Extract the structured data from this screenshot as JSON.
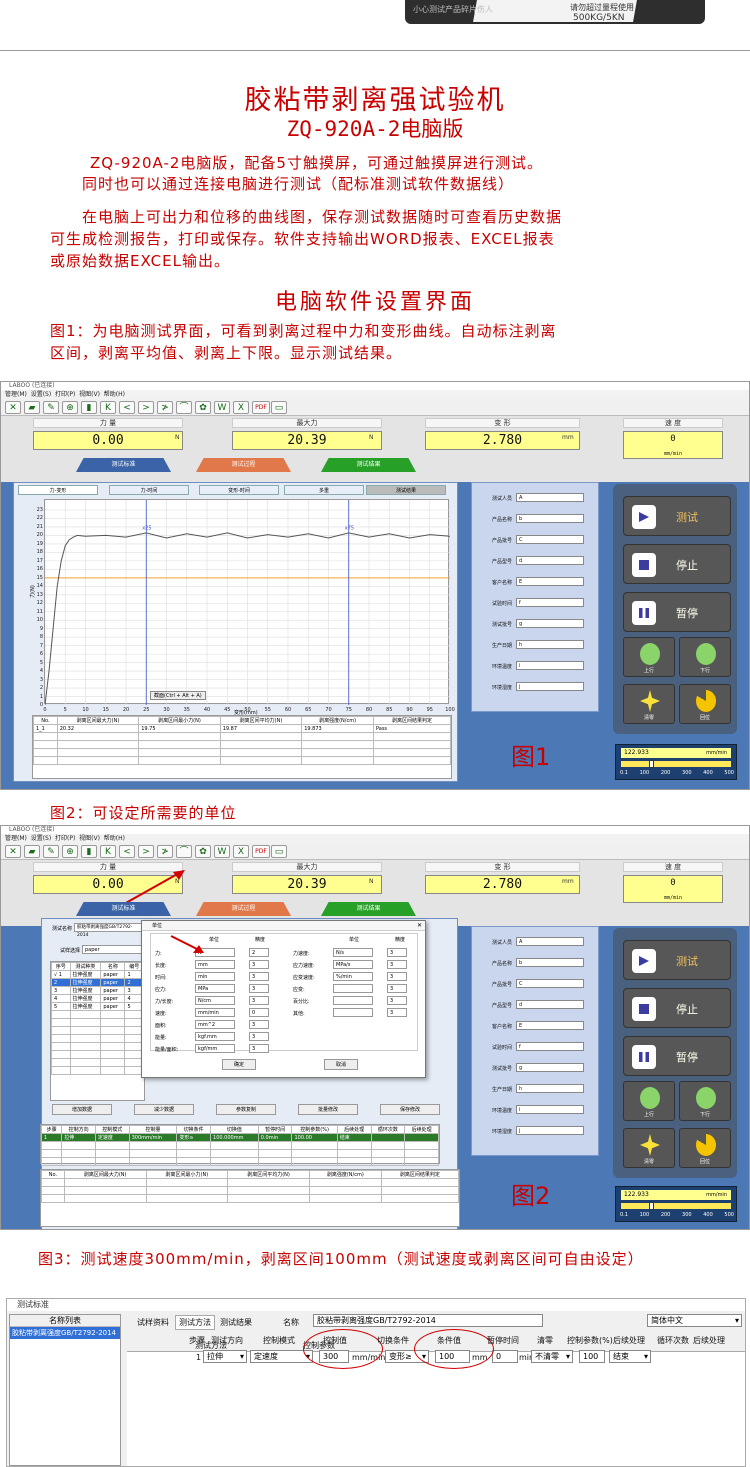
{
  "top_photo": {
    "caption_left": "小心测试产品碎片伤人",
    "caption_right": "请勿超过量程使用",
    "model_label": "500KG/5KN"
  },
  "title": "胶粘带剥离强试验机",
  "model": "ZQ-920A-2电脑版",
  "intro_lines": [
    "ZQ-920A-2电脑版，配备5寸触摸屏，可通过触摸屏进行测试。",
    "同时也可以通过连接电脑进行测试（配标准测试软件数据线）"
  ],
  "desc_lines": [
    "在电脑上可出力和位移的曲线图，保存测试数据随时可查看历史数据",
    "可生成检测报告，打印或保存。软件支持输出WORD报表、EXCEL报表",
    "或原始数据EXCEL输出。"
  ],
  "section_title": "电脑软件设置界面",
  "fig1_caption_lines": [
    "图1：为电脑测试界面，可看到剥离过程中力和变形曲线。自动标注剥离",
    "区间，剥离平均值、剥离上下限。显示测试结果。"
  ],
  "fig2_caption": "图2：可设定所需要的单位",
  "fig3_caption": "图3：测试速度300mm/min，剥离区间100mm（测试速度或剥离区间可自由设定）",
  "app": {
    "window_title": "LABOO (已连接)",
    "menu": [
      "管理(M)",
      "设置(S)",
      "打印(P)",
      "视图(V)",
      "帮助(H)"
    ],
    "toolbar_icons": [
      "tool-icon",
      "open-icon",
      "edit-icon",
      "zoom-icon",
      "delete-icon",
      "first-icon",
      "prev-icon",
      "next-icon",
      "last-icon",
      "curve-icon",
      "leaf-icon",
      "word-icon",
      "excel-icon",
      "pdf-icon",
      "monitor-icon"
    ],
    "toolbar_glyphs": [
      "✕",
      "▰",
      "✎",
      "⊕",
      "▮",
      "K",
      "<",
      ">",
      "≯",
      "⌒",
      "✿",
      "W",
      "X",
      "PDF",
      "▭"
    ],
    "panels": [
      {
        "label": "力  量",
        "value": "0.00",
        "unit": "N"
      },
      {
        "label": "最大力",
        "value": "20.39",
        "unit": "N"
      },
      {
        "label": "变  形",
        "value": "2.780",
        "unit": "mm"
      },
      {
        "label": "速  度",
        "value": "0",
        "unit": "mm/min"
      }
    ],
    "mode_tabs": [
      "测试标准",
      "测试过程",
      "测试结果"
    ],
    "chart_tabs": [
      "力-变形",
      "力-时间",
      "变形-时间",
      "多重",
      "测试结果"
    ],
    "info_fields": [
      "测试人员",
      "产品名称",
      "产品批号",
      "产品型号",
      "客户名称",
      "试验时间",
      "测试批号",
      "生产日期",
      "环境温度",
      "环境湿度"
    ],
    "info_values": [
      "A",
      "b",
      "C",
      "d",
      "E",
      "f",
      "g",
      "h",
      "i",
      "j"
    ],
    "control_buttons": {
      "test": "测试",
      "stop": "停止",
      "pause": "暂停",
      "up": "上行",
      "down": "下行",
      "reset": "清零",
      "return": "回位"
    },
    "speed_value": "122.933",
    "speed_unit": "mm/min",
    "speed_ticks": [
      "0.1",
      "100",
      "200",
      "300",
      "400",
      "500"
    ],
    "zoom_hint": "截面(Ctrl + Alt + A)",
    "result_headers": [
      "No.",
      "剥离区间最大力(N)",
      "剥离区间最小力(N)",
      "剥离区间平均力(N)",
      "剥离强度(N/cm)",
      "剥离区间结果判定"
    ],
    "result_row": [
      "1_1",
      "20.32",
      "19.75",
      "19.87",
      "19.873",
      "Pass"
    ],
    "fig1_label": "图1",
    "fig2_label": "图2"
  },
  "chart_data": {
    "type": "line",
    "x_label": "变形(mm)",
    "y_label": "力(N)",
    "xlim": [
      0,
      100
    ],
    "ylim": [
      0,
      23
    ],
    "x_ticks": [
      0,
      5,
      10,
      15,
      20,
      25,
      30,
      35,
      40,
      45,
      50,
      55,
      60,
      65,
      70,
      75,
      80,
      85,
      90,
      95,
      100
    ],
    "y_ticks": [
      0,
      1,
      2,
      3,
      4,
      5,
      6,
      7,
      8,
      9,
      10,
      11,
      12,
      13,
      14,
      15,
      16,
      17,
      18,
      19,
      20,
      21,
      22,
      23
    ],
    "series": [
      {
        "x": [
          0,
          1,
          2,
          3,
          4,
          5,
          6,
          7,
          8,
          10,
          15,
          20,
          25,
          30,
          35,
          40,
          45,
          50,
          55,
          60,
          65,
          70,
          75,
          80,
          85,
          90,
          95,
          100
        ],
        "y": [
          0,
          4,
          9,
          14,
          17,
          18.8,
          19.5,
          19.8,
          20,
          19.9,
          20,
          19.8,
          20.3,
          19.7,
          20.2,
          19.8,
          20.3,
          19.7,
          20.1,
          19.8,
          20.2,
          19.7,
          20.3,
          19.8,
          20.2,
          19.7,
          20.1,
          19.9
        ]
      }
    ],
    "markers": [
      {
        "x": 25,
        "label": "x25"
      },
      {
        "x": 75,
        "label": "x75"
      }
    ],
    "reference_line": {
      "y": 15
    }
  },
  "units_dialog": {
    "title": "单位",
    "col_headers": [
      "单位",
      "精度",
      "单位",
      "精度"
    ],
    "left_rows": [
      [
        "力:",
        "N",
        "2"
      ],
      [
        "长度:",
        "mm",
        "3"
      ],
      [
        "时间:",
        "min",
        "3"
      ],
      [
        "应力:",
        "MPa",
        "3"
      ],
      [
        "力/长度:",
        "N/cm",
        "3"
      ],
      [
        "速度:",
        "mm/min",
        "0"
      ],
      [
        "面积:",
        "mm^2",
        "3"
      ],
      [
        "能量:",
        "kgf.mm",
        "3"
      ],
      [
        "能量/面积:",
        "kgf/mm",
        "3"
      ]
    ],
    "right_rows": [
      [
        "力速度:",
        "N/s",
        "3"
      ],
      [
        "应力速度:",
        "MPa/s",
        "3"
      ],
      [
        "应变速度:",
        "%/min",
        "3"
      ],
      [
        "应变:",
        "",
        "3"
      ],
      [
        "百分比:",
        "",
        "3"
      ],
      [
        "其他:",
        "",
        "3"
      ]
    ],
    "ok": "确定",
    "cancel": "取消"
  },
  "standard_panel": {
    "name_label": "测试名称",
    "name_value": "胶粘带剥离强度GB/T2792-2014",
    "type_label": "试样选择",
    "type_value": "paper",
    "headers": [
      "序号",
      "测试种类",
      "名称",
      "编号"
    ],
    "rows": [
      [
        "√ 1",
        "拉伸强度",
        "paper",
        "1"
      ],
      [
        "2",
        "拉伸强度",
        "paper",
        "2"
      ],
      [
        "3",
        "拉伸强度",
        "paper",
        "3"
      ],
      [
        "4",
        "拉伸强度",
        "paper",
        "4"
      ],
      [
        "5",
        "拉伸强度",
        "paper",
        "5"
      ]
    ],
    "buttons": [
      "增加数据",
      "减少数据",
      "参数复制",
      "批量修改",
      "保存修改"
    ],
    "step_headers": [
      "步骤",
      "控制方向",
      "控制模式",
      "控制量",
      "切换条件",
      "切换值",
      "暂停时间",
      "控制参数(%)",
      "后续处理",
      "循环次数",
      "后续处理"
    ],
    "step_row": [
      "1",
      "拉伸",
      "定速度",
      "300mm/min",
      "变形≥",
      "100.000mm",
      "0.0min",
      "100.00",
      "结束"
    ],
    "result_headers": [
      "No.",
      "剥离区间最大力(N)",
      "剥离区间最小力(N)",
      "剥离区间平均力(N)",
      "剥离强度(N/cm)",
      "剥离区间结果判定"
    ]
  },
  "standard_window": {
    "title": "测试标准",
    "list_header": "名称列表",
    "list_item": "胶粘带剥离强度GB/T2792-2014",
    "tabs": [
      "试样资料",
      "测试方法",
      "测试结果"
    ],
    "name_label": "名称",
    "name_value": "胶粘带剥离强度GB/T2792-2014",
    "language": "简体中文",
    "sub_tabs": [
      "测试方法",
      "控制参数"
    ],
    "headers": [
      "步骤",
      "测试方向",
      "控制模式",
      "控制值",
      "切换条件",
      "条件值",
      "暂停时间",
      "清零",
      "控制参数(%)",
      "后续处理",
      "循环次数",
      "后续处理"
    ],
    "row": {
      "step": "1",
      "direction": "拉伸",
      "mode": "定速度",
      "control_value": "300",
      "control_unit": "mm/min",
      "condition": "变形≥",
      "condition_value": "100",
      "condition_unit": "mm",
      "pause": "0",
      "pause_unit": "min",
      "zero": "不清零",
      "param": "100",
      "after": "结束"
    }
  },
  "colors": {
    "accent_red": "#c80000",
    "panel_yellow": "#ffff90",
    "body_blue": "#4d78b6",
    "tab_blue": "#3b63a8",
    "tab_orange": "#e0784a",
    "tab_green": "#26a026"
  }
}
